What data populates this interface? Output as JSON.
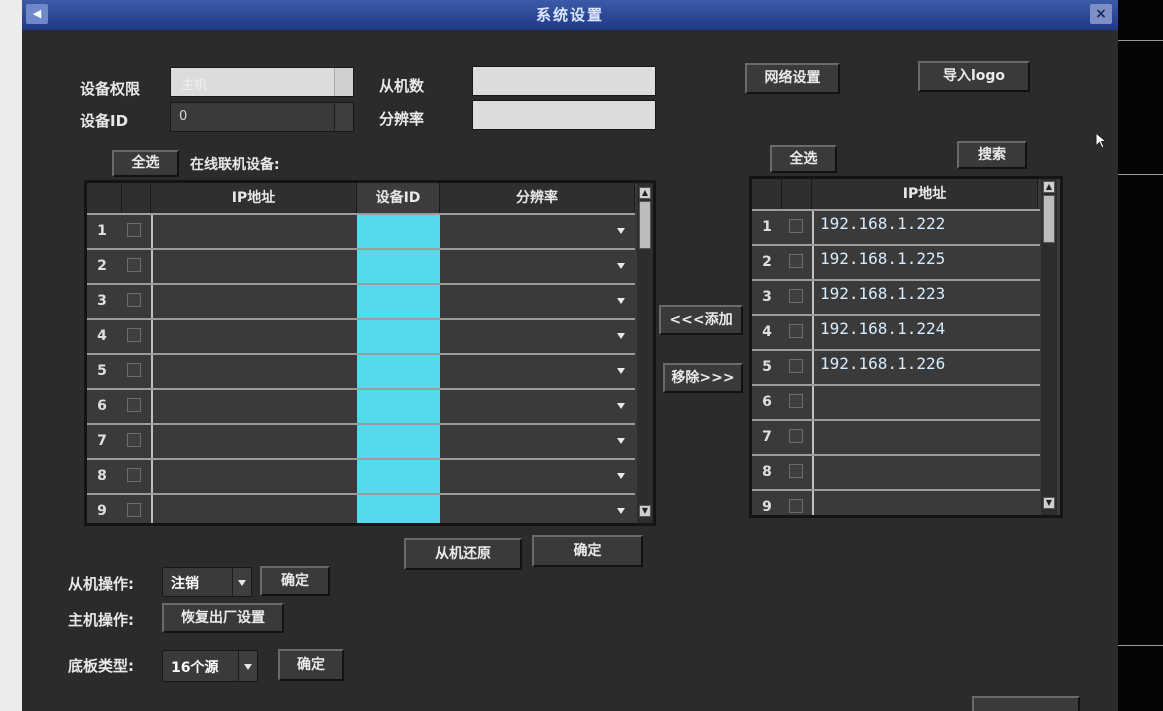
{
  "window": {
    "title": "系统设置",
    "close_glyph": "×",
    "back_glyph": "◀"
  },
  "fields": {
    "device_permission_label": "设备权限",
    "device_permission_value": "主机",
    "device_id_label": "设备ID",
    "device_id_value": "0",
    "slave_count_label": "从机数",
    "resolution_label": "分辨率"
  },
  "buttons": {
    "network_settings": "网络设置",
    "import_logo": "导入logo",
    "select_all_left": "全选",
    "select_all_right": "全选",
    "search": "搜索",
    "add": "<<<添加",
    "remove": "移除>>>",
    "slave_restore": "从机还原",
    "confirm_main": "确定",
    "confirm_slave": "确定",
    "factory_reset": "恢复出厂设置",
    "confirm_board": "确定"
  },
  "online_devices_label": "在线联机设备:",
  "left_table": {
    "headers": [
      "IP地址",
      "设备ID",
      "分辨率"
    ],
    "rows": [
      "1",
      "2",
      "3",
      "4",
      "5",
      "6",
      "7",
      "8",
      "9"
    ]
  },
  "right_table": {
    "headers": [
      "IP地址"
    ],
    "rows": [
      {
        "n": "1",
        "ip": "192.168.1.222"
      },
      {
        "n": "2",
        "ip": "192.168.1.225"
      },
      {
        "n": "3",
        "ip": "192.168.1.223"
      },
      {
        "n": "4",
        "ip": "192.168.1.224"
      },
      {
        "n": "5",
        "ip": "192.168.1.226"
      },
      {
        "n": "6",
        "ip": ""
      },
      {
        "n": "7",
        "ip": ""
      },
      {
        "n": "8",
        "ip": ""
      },
      {
        "n": "9",
        "ip": ""
      }
    ]
  },
  "operations": {
    "slave_op_label": "从机操作:",
    "slave_op_value": "注销",
    "host_op_label": "主机操作:",
    "board_type_label": "底板类型:",
    "board_type_value": "16个源"
  },
  "colors": {
    "cyan_column": "#53d8ec",
    "title_bar": "#2a4795"
  }
}
